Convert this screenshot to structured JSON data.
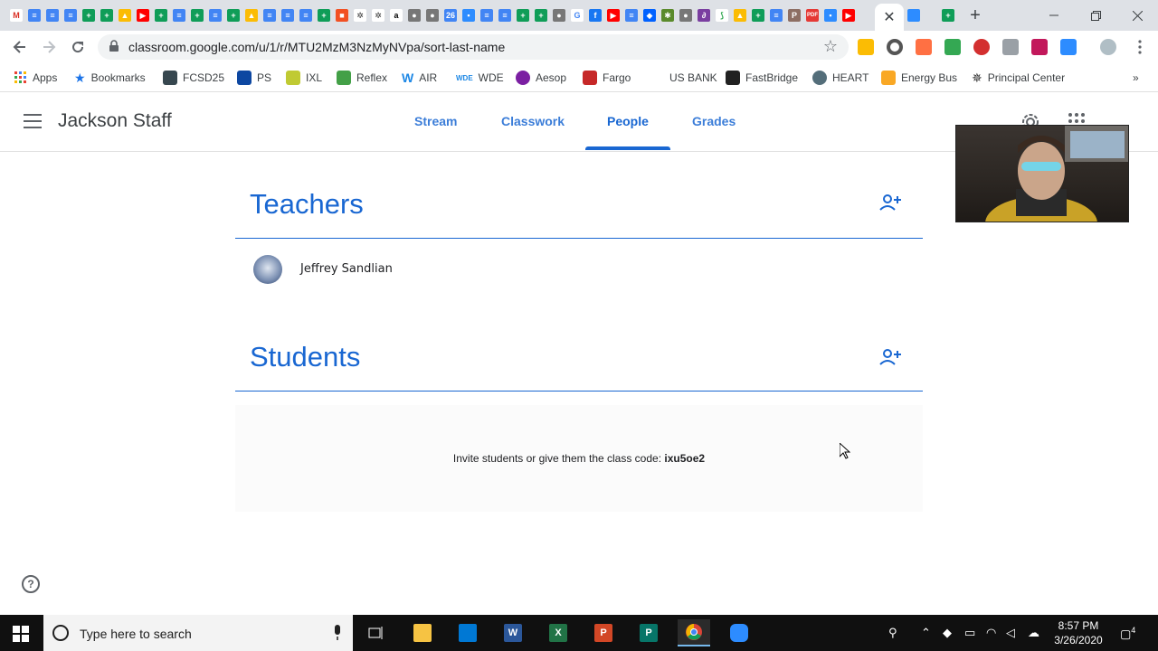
{
  "browser": {
    "tab_close": "✕",
    "new_tab": "+",
    "address": "classroom.google.com/u/1/r/MTU2MzM3NzMyNVpa/sort-last-name",
    "bookmarks": [
      "Apps",
      "Bookmarks",
      "FCSD25",
      "PS",
      "IXL",
      "Reflex",
      "AIR",
      "WDE",
      "Aesop",
      "Fargo",
      "US BANK",
      "FastBridge",
      "HEART",
      "Energy Bus",
      "Principal Center"
    ],
    "more": "»"
  },
  "classroom": {
    "class_name": "Jackson Staff",
    "tabs": [
      "Stream",
      "Classwork",
      "People",
      "Grades"
    ],
    "active_tab": "People",
    "teachers_heading": "Teachers",
    "teachers": [
      "Jeffrey Sandlian"
    ],
    "students_heading": "Students",
    "invite_prefix": "Invite students or give them the class code: ",
    "class_code": "ixu5oe2",
    "help": "?"
  },
  "taskbar": {
    "search_placeholder": "Type here to search",
    "time": "8:57 PM",
    "date": "3/26/2020",
    "notifications": "4"
  },
  "colors": {
    "accent": "#1967d2",
    "tabstrip": "#dee1e6",
    "taskbar": "#101010"
  }
}
